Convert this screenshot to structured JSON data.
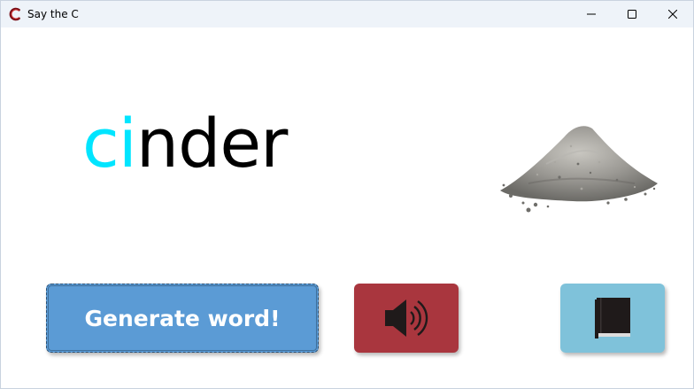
{
  "window": {
    "title": "Say the C",
    "app_icon": "c-logo-icon",
    "controls": [
      "minimize-icon",
      "maximize-icon",
      "close-icon"
    ]
  },
  "word": {
    "highlight": "ci",
    "rest": "nder",
    "highlight_color": "#00e5ff",
    "text_color": "#000000"
  },
  "picture": {
    "subject": "cinder pile"
  },
  "buttons": {
    "generate_label": "Generate word!",
    "generate_color": "#5b9bd5",
    "sound_icon": "speaker-icon",
    "sound_color": "#a9363e",
    "book_icon": "book-icon",
    "book_color": "#7fc2da"
  }
}
